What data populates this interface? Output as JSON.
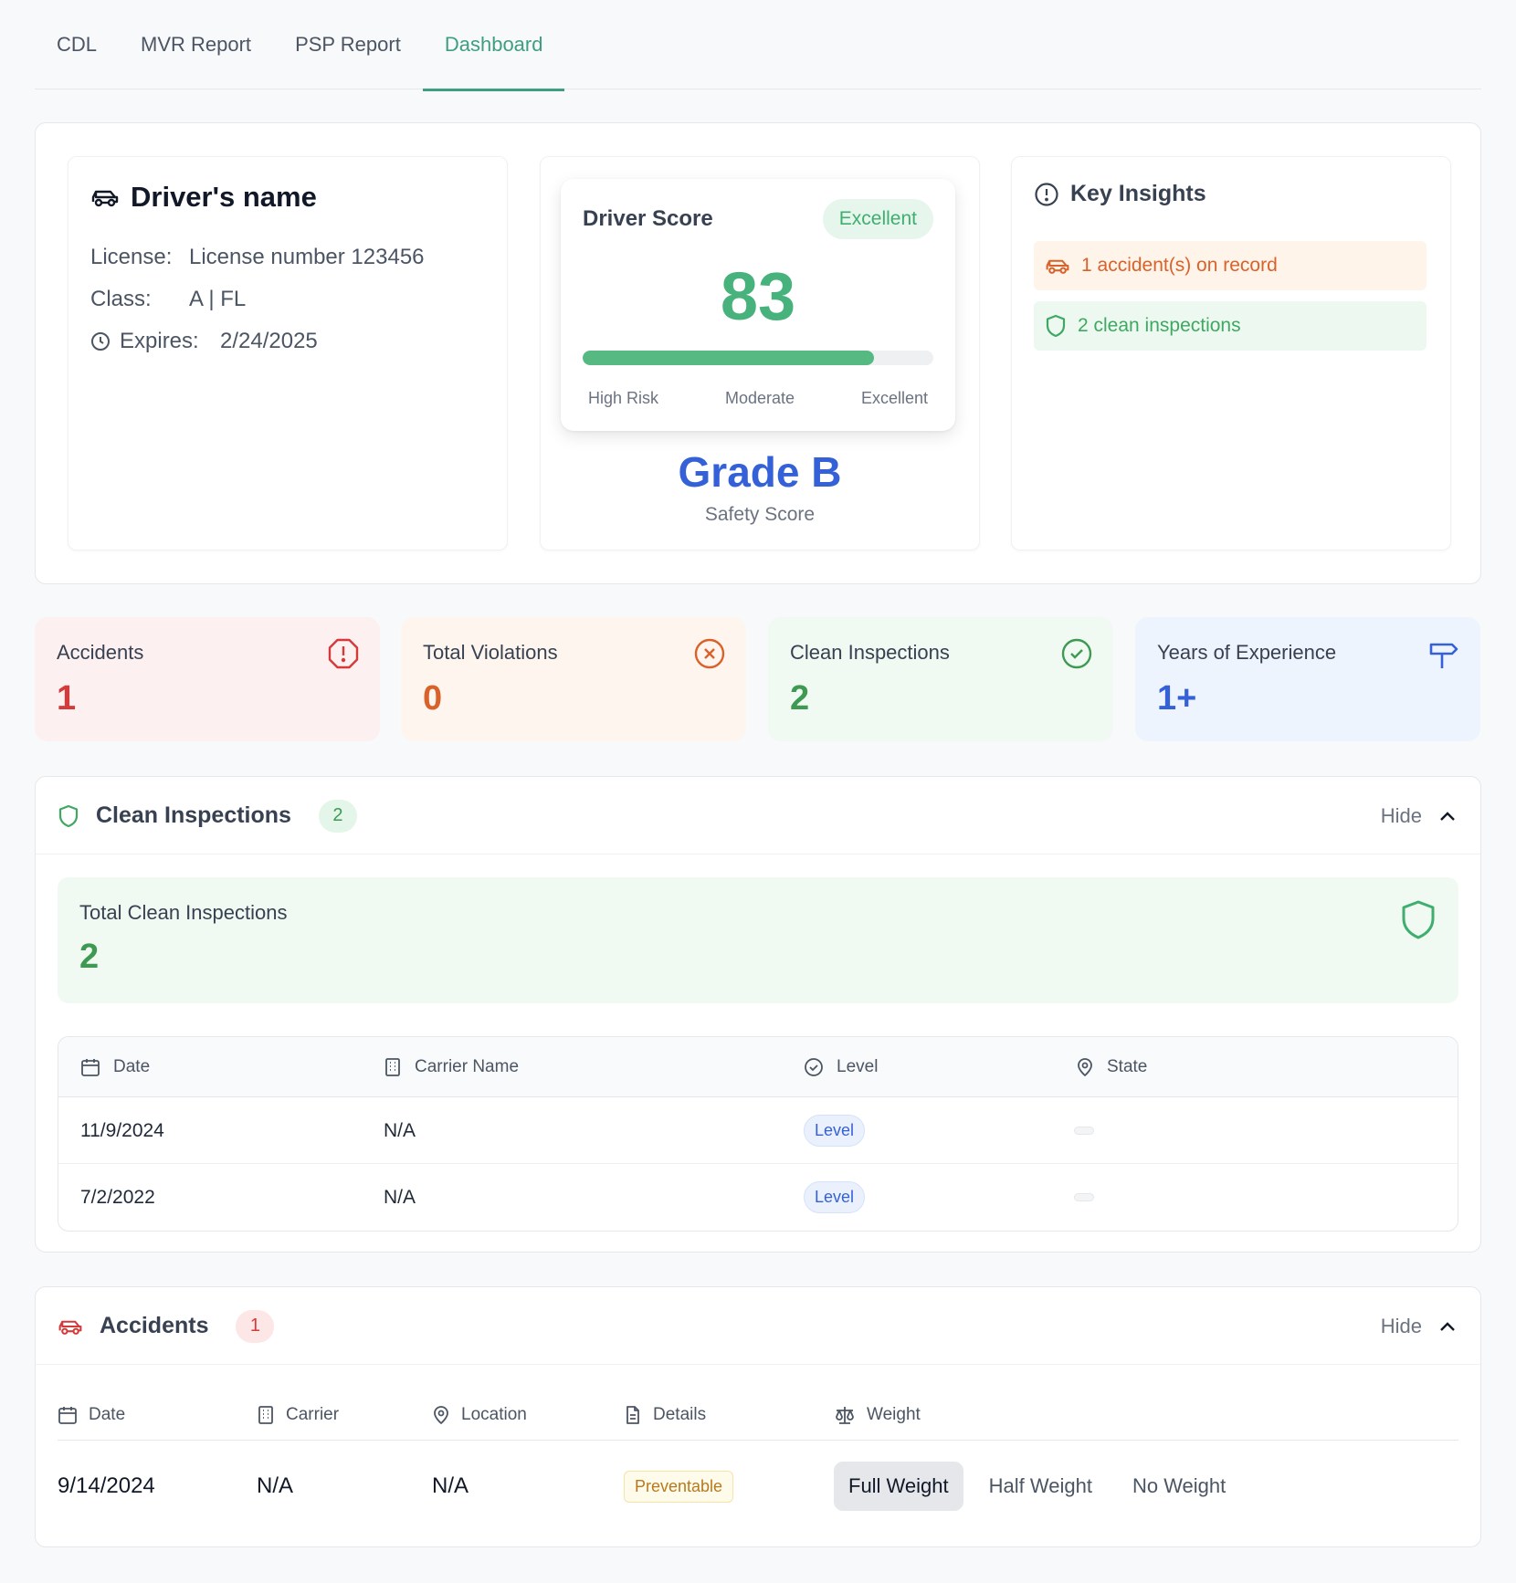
{
  "tabs": [
    "CDL",
    "MVR Report",
    "PSP Report",
    "Dashboard"
  ],
  "active_tab": "Dashboard",
  "driver": {
    "name": "Driver's name",
    "license_label": "License:",
    "license_value": "License number 123456",
    "class_label": "Class:",
    "class_value": "A | FL",
    "expires_label": "Expires:",
    "expires_value": "2/24/2025"
  },
  "score": {
    "title": "Driver Score",
    "badge": "Excellent",
    "value": "83",
    "progress_percent": 83,
    "labels": [
      "High Risk",
      "Moderate",
      "Excellent"
    ],
    "grade": "Grade B",
    "grade_sub": "Safety Score"
  },
  "insights": {
    "title": "Key Insights",
    "items": [
      "1 accident(s) on record",
      "2 clean inspections"
    ]
  },
  "stats": [
    {
      "label": "Accidents",
      "value": "1"
    },
    {
      "label": "Total Violations",
      "value": "0"
    },
    {
      "label": "Clean Inspections",
      "value": "2"
    },
    {
      "label": "Years of Experience",
      "value": "1+"
    }
  ],
  "clean_section": {
    "title": "Clean Inspections",
    "count": "2",
    "hide_label": "Hide",
    "total_label": "Total Clean Inspections",
    "total_value": "2",
    "columns": [
      "Date",
      "Carrier Name",
      "Level",
      "State"
    ],
    "rows": [
      {
        "date": "11/9/2024",
        "carrier": "N/A",
        "level": "Level"
      },
      {
        "date": "7/2/2022",
        "carrier": "N/A",
        "level": "Level"
      }
    ]
  },
  "accidents_section": {
    "title": "Accidents",
    "count": "1",
    "hide_label": "Hide",
    "columns": [
      "Date",
      "Carrier",
      "Location",
      "Details",
      "Weight"
    ],
    "rows": [
      {
        "date": "9/14/2024",
        "carrier": "N/A",
        "location": "N/A",
        "details": "Preventable"
      }
    ],
    "weight_options": [
      "Full Weight",
      "Half Weight",
      "No Weight"
    ],
    "weight_selected": "Full Weight"
  },
  "colors": {
    "accent": "#3f9d80",
    "score_green": "#48b27c",
    "grade_blue": "#3561d8",
    "danger": "#d43a3a",
    "warning": "#d9622b"
  }
}
